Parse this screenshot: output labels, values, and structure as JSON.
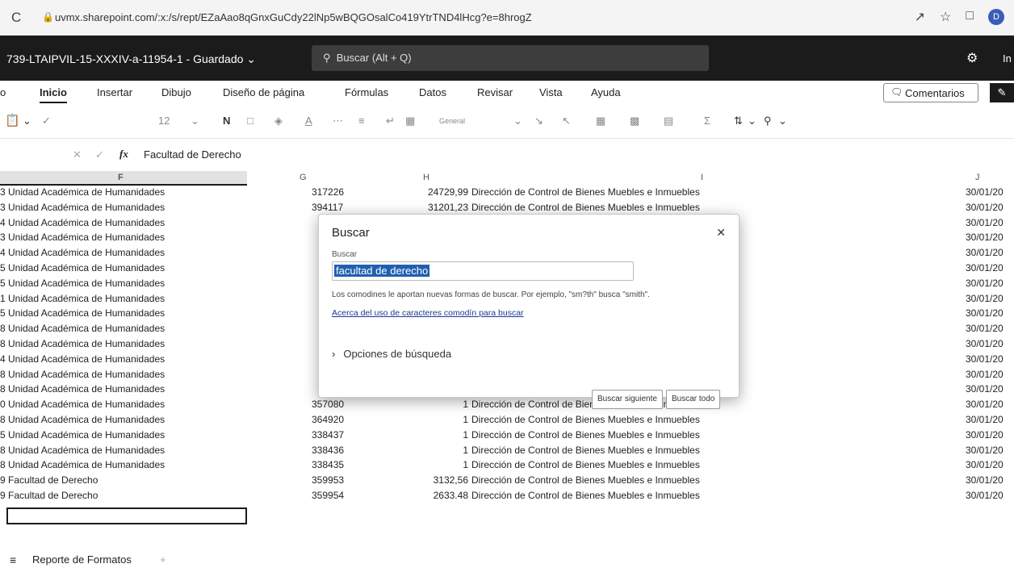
{
  "browser": {
    "url": "uvmx.sharepoint.com/:x:/s/rept/EZaAao8qGnxGuCdy22lNp5wBQGOsalCo419YtrTND4lHcg?e=8hrogZ",
    "avatar_letter": "D"
  },
  "app": {
    "doc_title": "739-LTAIPVIL-15-XXXIV-a-11954-1 - Guardado",
    "search_placeholder": "Buscar (Alt + Q)",
    "user_initial": "In"
  },
  "ribbon": {
    "tabs": [
      "o",
      "Inicio",
      "Insertar",
      "Dibujo",
      "Diseño de página",
      "Fórmulas",
      "Datos",
      "Revisar",
      "Vista",
      "Ayuda"
    ],
    "active_tab": "Inicio",
    "comments_label": "Comentarios",
    "font_size": "12",
    "bold": "N",
    "number_format": "General"
  },
  "formula_bar": {
    "fx": "fx",
    "value": "Facultad de Derecho"
  },
  "grid": {
    "column_headers": [
      "F",
      "G",
      "H",
      "I",
      "J"
    ],
    "rows": [
      {
        "e": "3",
        "f": "Unidad Académica de Humanidades",
        "g": "317226",
        "h": "24729,99",
        "i": "Dirección de Control de Bienes Muebles e Inmuebles",
        "j": "30/01/20"
      },
      {
        "e": "3",
        "f": "Unidad Académica de Humanidades",
        "g": "394117",
        "h": "31201,23",
        "i": "Dirección de Control de Bienes Muebles e Inmuebles",
        "j": "30/01/20"
      },
      {
        "e": "4",
        "f": "Unidad Académica de Humanidades",
        "g": "",
        "h": "",
        "i": "les",
        "j": "30/01/20"
      },
      {
        "e": "3",
        "f": "Unidad Académica de Humanidades",
        "g": "",
        "h": "",
        "i": "les",
        "j": "30/01/20"
      },
      {
        "e": "4",
        "f": "Unidad Académica de Humanidades",
        "g": "",
        "h": "",
        "i": "les",
        "j": "30/01/20"
      },
      {
        "e": "5",
        "f": "Unidad Académica de Humanidades",
        "g": "",
        "h": "",
        "i": "les",
        "j": "30/01/20"
      },
      {
        "e": "5",
        "f": "Unidad Académica de Humanidades",
        "g": "",
        "h": "",
        "i": "les",
        "j": "30/01/20"
      },
      {
        "e": "1",
        "f": "Unidad Académica de Humanidades",
        "g": "",
        "h": "",
        "i": "les",
        "j": "30/01/20"
      },
      {
        "e": "5",
        "f": "Unidad Académica de Humanidades",
        "g": "",
        "h": "",
        "i": "les",
        "j": "30/01/20"
      },
      {
        "e": "8",
        "f": "Unidad Académica de Humanidades",
        "g": "",
        "h": "",
        "i": "les",
        "j": "30/01/20"
      },
      {
        "e": "8",
        "f": "Unidad Académica de Humanidades",
        "g": "",
        "h": "",
        "i": "les",
        "j": "30/01/20"
      },
      {
        "e": "4",
        "f": "Unidad Académica de Humanidades",
        "g": "",
        "h": "",
        "i": "les",
        "j": "30/01/20"
      },
      {
        "e": "8",
        "f": "Unidad Académica de Humanidades",
        "g": "",
        "h": "",
        "i": "les",
        "j": "30/01/20"
      },
      {
        "e": "8",
        "f": "Unidad Académica de Humanidades",
        "g": "",
        "h": "",
        "i": "les",
        "j": "30/01/20"
      },
      {
        "e": "0",
        "f": "Unidad Académica de Humanidades",
        "g": "357080",
        "h": "1",
        "i": "Dirección de Control de Bienes Muebles e Inmuebles",
        "j": "30/01/20"
      },
      {
        "e": "8",
        "f": "Unidad Académica de Humanidades",
        "g": "364920",
        "h": "1",
        "i": "Dirección de Control de Bienes Muebles e Inmuebles",
        "j": "30/01/20"
      },
      {
        "e": "5",
        "f": "Unidad Académica de Humanidades",
        "g": "338437",
        "h": "1",
        "i": "Dirección de Control de Bienes Muebles e Inmuebles",
        "j": "30/01/20"
      },
      {
        "e": "8",
        "f": "Unidad Académica de Humanidades",
        "g": "338436",
        "h": "1",
        "i": "Dirección de Control de Bienes Muebles e Inmuebles",
        "j": "30/01/20"
      },
      {
        "e": "8",
        "f": "Unidad Académica de Humanidades",
        "g": "338435",
        "h": "1",
        "i": "Dirección de Control de Bienes Muebles e Inmuebles",
        "j": "30/01/20"
      },
      {
        "e": "9",
        "f": "Facultad de Derecho",
        "g": "359953",
        "h": "3132,56",
        "i": "Dirección de Control de Bienes Muebles e Inmuebles",
        "j": "30/01/20"
      },
      {
        "e": "9",
        "f": "Facultad de Derecho",
        "g": "359954",
        "h": "2633.48",
        "i": "Dirección de Control de Bienes Muebles e Inmuebles",
        "j": "30/01/20"
      }
    ]
  },
  "sheet": {
    "name": "Reporte de Formatos",
    "add_label": "+"
  },
  "find_dialog": {
    "title": "Buscar",
    "search_label": "Buscar",
    "search_value": "facultad de derecho",
    "hint": "Los comodines le aportan nuevas formas de buscar. Por ejemplo, \"sm?th\" busca \"smith\".",
    "link": "Acerca del uso de caracteres comodín para buscar",
    "options_label": "Opciones de búsqueda",
    "find_next_label": "Buscar siguiente",
    "find_all_label": "Buscar todo"
  },
  "colors": {
    "titlebar_bg": "#1b1b1b",
    "selection_blue": "#1f5fb0",
    "link_blue": "#1a3c8c"
  }
}
